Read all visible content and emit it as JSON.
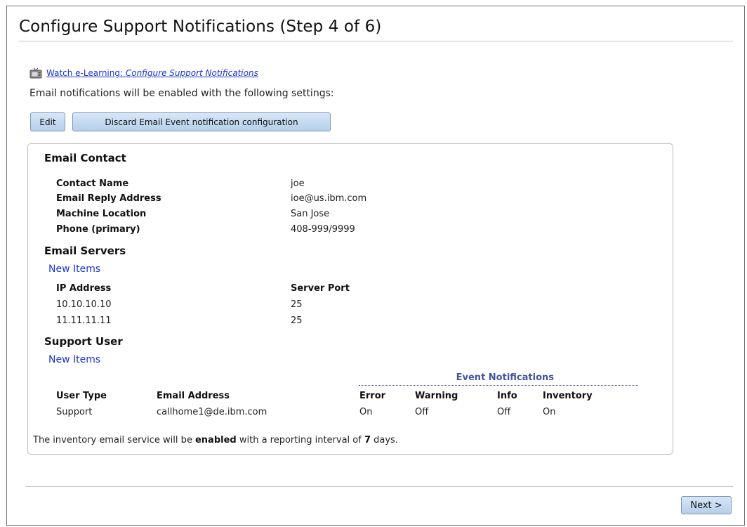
{
  "page": {
    "title": "Configure Support Notifications (Step 4 of 6)",
    "elearning_prefix": "Watch e-Learning: ",
    "elearning_topic": "Configure Support Notifications",
    "intro": "Email notifications will be enabled with the following settings:"
  },
  "toolbar": {
    "edit_label": "Edit",
    "discard_label": "Discard Email Event notification configuration"
  },
  "email_contact": {
    "heading": "Email Contact",
    "fields": [
      {
        "label": "Contact Name",
        "value": "joe"
      },
      {
        "label": "Email Reply Address",
        "value": "ioe@us.ibm.com"
      },
      {
        "label": "Machine Location",
        "value": "San Jose"
      },
      {
        "label": "Phone (primary)",
        "value": "408-999/9999"
      }
    ]
  },
  "email_servers": {
    "heading": "Email Servers",
    "new_items_label": "New Items",
    "columns": [
      "IP Address",
      "Server Port"
    ],
    "rows": [
      [
        "10.10.10.10",
        "25"
      ],
      [
        "11.11.11.11",
        "25"
      ]
    ]
  },
  "support_user": {
    "heading": "Support User",
    "new_items_label": "New Items",
    "event_notifications_label": "Event Notifications",
    "columns": [
      "User Type",
      "Email Address",
      "Error",
      "Warning",
      "Info",
      "Inventory"
    ],
    "rows": [
      [
        "Support",
        "callhome1@de.ibm.com",
        "On",
        "Off",
        "Off",
        "On"
      ]
    ]
  },
  "inventory_note": {
    "prefix": "The inventory email service will be ",
    "state": "enabled",
    "middle": " with a reporting interval of ",
    "days": "7",
    "suffix": " days."
  },
  "footer": {
    "next_label": "Next >"
  }
}
